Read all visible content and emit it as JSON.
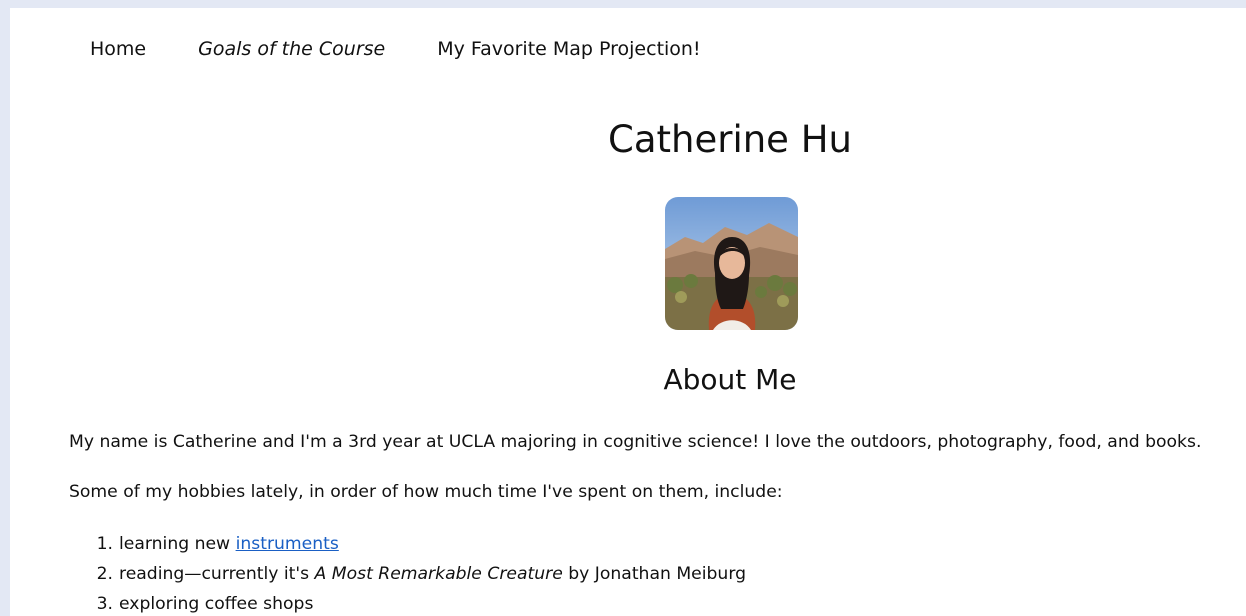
{
  "nav": {
    "items": [
      {
        "label": "Home"
      },
      {
        "label": "Goals of the Course"
      },
      {
        "label": "My Favorite Map Projection!"
      }
    ]
  },
  "title": "Catherine Hu",
  "about_heading": "About Me",
  "intro": "My name is Catherine and I'm a 3rd year at UCLA majoring in cognitive science! I love the outdoors, photography, food, and books.",
  "hobbies_intro": "Some of my hobbies lately, in order of how much time I've spent on them, include:",
  "hobbies": {
    "item1": {
      "num": "1.",
      "before": "learning new ",
      "link": "instruments"
    },
    "item2": {
      "num": "2.",
      "before": "reading—currently it's ",
      "book": "A Most Remarkable Creature",
      "after": " by Jonathan Meiburg"
    },
    "item3": {
      "num": "3.",
      "text": "exploring coffee shops"
    }
  },
  "colors": {
    "page_bg": "#e3e8f4",
    "content_bg": "#ffffff",
    "link": "#1a5fc4"
  }
}
